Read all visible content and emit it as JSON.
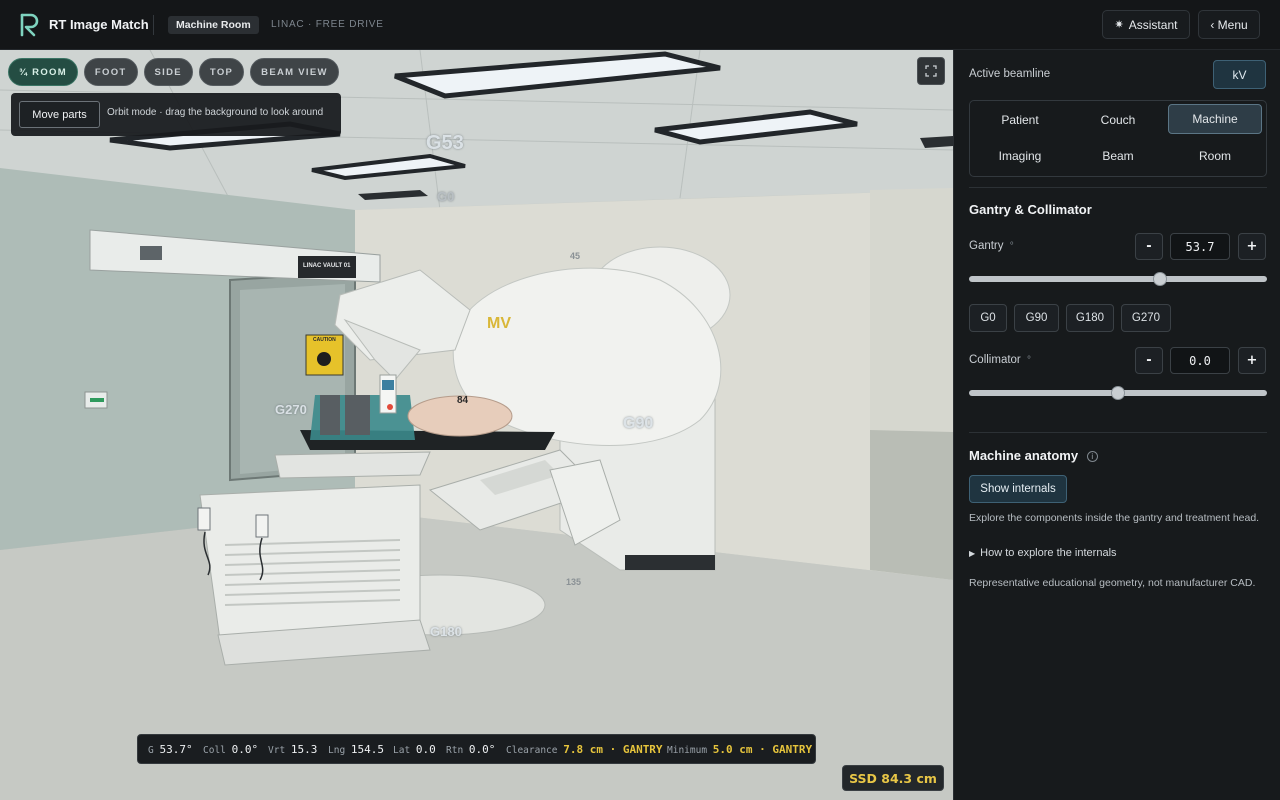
{
  "header": {
    "app_title": "RT Image Match",
    "room_pill": "Machine Room",
    "mode_label": "LINAC · FREE DRIVE",
    "assistant_label": "Assistant",
    "assistant_icon": "sparkle-icon",
    "menu_label": "‹ Menu"
  },
  "viewport": {
    "view_buttons": [
      {
        "label": "¾ ROOM",
        "active": true
      },
      {
        "label": "FOOT",
        "active": false
      },
      {
        "label": "SIDE",
        "active": false
      },
      {
        "label": "TOP",
        "active": false
      },
      {
        "label": "BEAM VIEW",
        "active": false
      }
    ],
    "expand_icon": "fullscreen-icon",
    "move_parts_label": "Move parts",
    "orbit_hint": "Orbit mode · drag the background to look around",
    "scene_labels": {
      "g53": "G53",
      "g0": "G0",
      "g270": "G270",
      "g90": "G90",
      "g180": "G180",
      "mv": "MV",
      "n84": "84",
      "n45": "45",
      "n135": "135",
      "sign": "LINAC VAULT 01",
      "caution": "CAUTION"
    },
    "status": {
      "g_label": "G",
      "g_value": "53.7°",
      "coll_label": "Coll",
      "coll_value": "0.0°",
      "vrt_label": "Vrt",
      "vrt_value": "15.3",
      "lng_label": "Lng",
      "lng_value": "154.5",
      "lat_label": "Lat",
      "lat_value": "0.0",
      "rtn_label": "Rtn",
      "rtn_value": "0.0°",
      "clearance_label": "Clearance",
      "clearance_value": "7.8 cm · GANTRY",
      "minimum_label": "Minimum",
      "minimum_value": "5.0 cm · GANTRY"
    },
    "ssd": "SSD 84.3 cm"
  },
  "panel": {
    "active_beamline_label": "Active beamline",
    "beamline_value": "kV",
    "tabs": [
      {
        "label": "Patient",
        "active": false
      },
      {
        "label": "Couch",
        "active": false
      },
      {
        "label": "Machine",
        "active": true
      },
      {
        "label": "Imaging",
        "active": false
      },
      {
        "label": "Beam",
        "active": false
      },
      {
        "label": "Room",
        "active": false
      }
    ],
    "gantry_section_title": "Gantry & Collimator",
    "gantry": {
      "label": "Gantry",
      "unit": "°",
      "value": "53.7",
      "minus": "-",
      "plus": "+",
      "slider_fraction": 0.64
    },
    "presets": [
      "G0",
      "G90",
      "G180",
      "G270"
    ],
    "collimator": {
      "label": "Collimator",
      "unit": "°",
      "value": "0.0",
      "minus": "-",
      "plus": "+",
      "slider_fraction": 0.5
    },
    "anatomy_title": "Machine anatomy",
    "anatomy_info_icon": "info-icon",
    "show_internals_label": "Show internals",
    "anatomy_desc": "Explore the components inside the gantry and treatment head.",
    "how_to_label": "How to explore the internals",
    "disclaimer": "Representative educational geometry, not manufacturer CAD."
  },
  "colors": {
    "accent_teal": "#244d43",
    "accent_blue": "#1f3440",
    "warning_yellow": "#e6c43c"
  }
}
